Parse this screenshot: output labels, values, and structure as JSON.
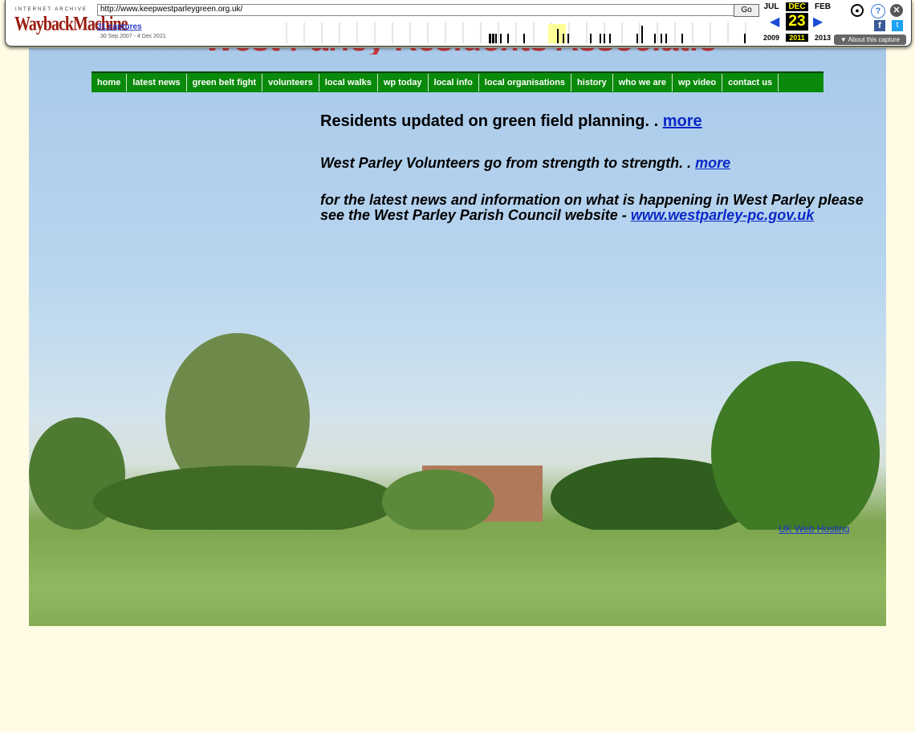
{
  "wayback": {
    "logo_top": "INTERNET ARCHIVE",
    "logo": "WaybackMachine",
    "url": "http://www.keepwestparleygreen.org.uk/",
    "go_label": "Go",
    "captures": "31 captures",
    "range": "30 Sep 2007 - 4 Dec 2021",
    "prev_month": "JUL",
    "cur_month": "DEC",
    "next_month": "FEB",
    "day": "23",
    "prev_year": "2009",
    "cur_year": "2011",
    "next_year": "2013",
    "about": "About this capture",
    "colors": {
      "accent": "#ffff00",
      "arrow": "#1a4cd8"
    }
  },
  "site": {
    "title": "West Parley Residents Association",
    "nav": [
      "home",
      "latest news",
      "green belt fight",
      "volunteers",
      "local walks",
      "wp today",
      "local info",
      "local organisations",
      "history",
      "who we are",
      "wp video",
      "contact us"
    ],
    "headline": "Residents updated on green field planning. . ",
    "headline_link": "more",
    "sub": "West Parley Volunteers go from strength to strength. . ",
    "sub_link": "more",
    "info": "for the latest news and information on what is happening in West Parley please see the West Parley Parish Council website - ",
    "info_link": "www.westparley-pc.gov.uk",
    "hosting": "UK Web Hosting",
    "colors": {
      "nav_bg": "#0a8a0a",
      "link": "#0a28c8",
      "page_bg": "#fffbe5"
    }
  }
}
